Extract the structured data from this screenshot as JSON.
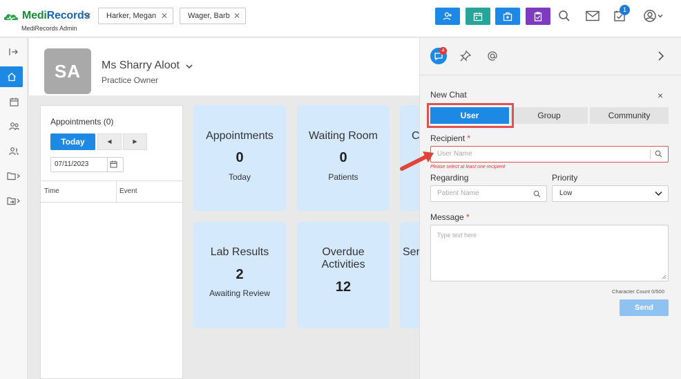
{
  "app": {
    "logo_text_green": "Medi",
    "logo_text_blue": "Records",
    "logo_sub": "MediRecords Admin"
  },
  "patient_tabs": [
    {
      "label": "Harker, Megan"
    },
    {
      "label": "Wager, Barb"
    }
  ],
  "header": {
    "task_badge": "1"
  },
  "patient": {
    "initials": "SA",
    "name": "Ms Sharry Aloot",
    "role": "Practice Owner"
  },
  "appointments": {
    "title": "Appointments (0)",
    "today_label": "Today",
    "prev_label": "◀",
    "next_label": "▶",
    "date_value": "07/11/2023",
    "col_time": "Time",
    "col_event": "Event"
  },
  "cards": [
    {
      "title": "Appointments",
      "value": "0",
      "sub": "Today"
    },
    {
      "title": "Waiting Room",
      "value": "0",
      "sub": "Patients"
    },
    {
      "title": "Co",
      "value": "",
      "sub": ""
    },
    {
      "title": "Lab Results",
      "value": "2",
      "sub": "Awaiting Review"
    },
    {
      "title": "Overdue Activities",
      "value": "12",
      "sub": ""
    },
    {
      "title": "Ser",
      "value": "",
      "sub": ""
    }
  ],
  "drawer": {
    "chat_badge": "4",
    "new_chat_title": "New Chat",
    "close": "×",
    "tabs": [
      "User",
      "Group",
      "Community"
    ],
    "recipient_label": "Recipient",
    "required_mark": "*",
    "recipient_placeholder": "User Name",
    "recipient_error": "Please select at least one recipient",
    "regarding_label": "Regarding",
    "regarding_placeholder": "Patient Name",
    "priority_label": "Priority",
    "priority_value": "Low",
    "message_label": "Message",
    "message_placeholder": "Type text here",
    "char_count": "Character Count 0/500",
    "send_label": "Send"
  },
  "colors": {
    "primary": "#1e88e5",
    "teal": "#26a69a",
    "purple": "#7e3bbf",
    "card_bg": "#d5e9fd",
    "error": "#e53935"
  }
}
